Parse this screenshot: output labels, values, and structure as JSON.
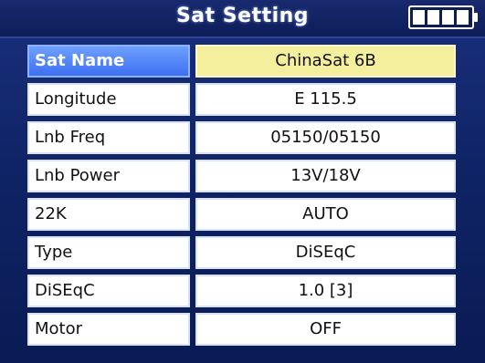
{
  "window": {
    "title": "Sat Setting",
    "battery_icon": "battery-icon"
  },
  "settings": [
    {
      "label": "Sat Name",
      "value": "ChinaSat 6B",
      "selected": true
    },
    {
      "label": "Longitude",
      "value": "E  115.5"
    },
    {
      "label": "Lnb Freq",
      "value": "05150/05150"
    },
    {
      "label": "Lnb Power",
      "value": "13V/18V"
    },
    {
      "label": "22K",
      "value": "AUTO"
    },
    {
      "label": "Type",
      "value": "DiSEqC"
    },
    {
      "label": "DiSEqC",
      "value": "1.0 [3]"
    },
    {
      "label": "Motor",
      "value": "OFF"
    }
  ],
  "colors": {
    "selected_label": "#3d6ff2",
    "selected_value": "#f3ef9d",
    "background": "#0f2466"
  }
}
